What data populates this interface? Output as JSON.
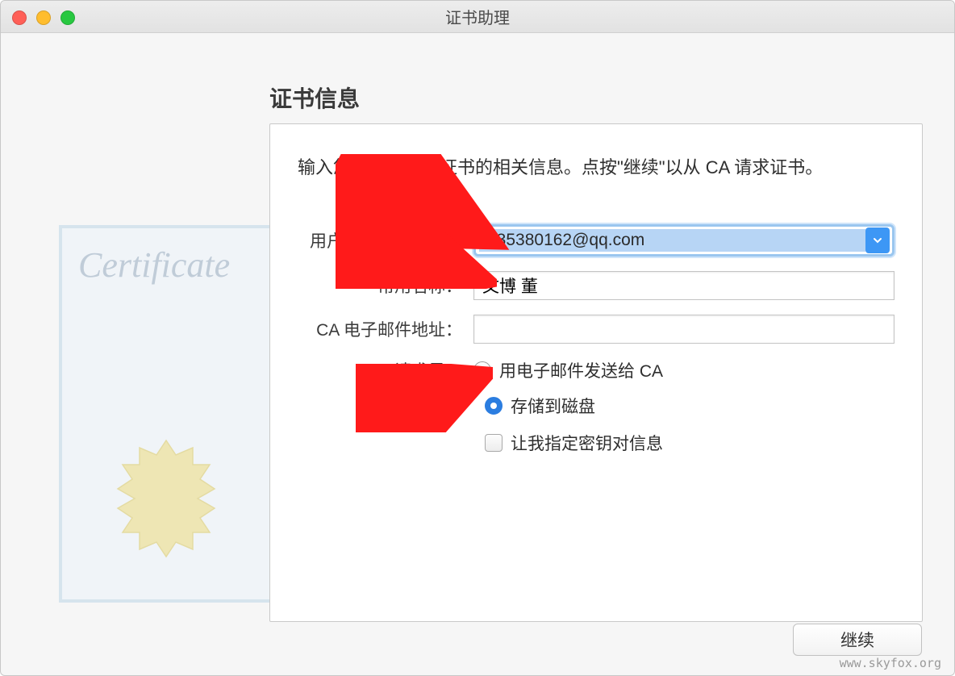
{
  "window": {
    "title": "证书助理"
  },
  "section": {
    "title": "证书信息",
    "instruction": "输入您正在请求的证书的相关信息。点按\"继续\"以从 CA 请求证书。"
  },
  "form": {
    "email_label": "用户电子邮件地址：",
    "email_value": "935380162@qq.com",
    "common_name_label": "常用名称：",
    "common_name_value": "文博 董",
    "ca_email_label": "CA 电子邮件地址：",
    "ca_email_value": "",
    "request_label": "请求是：",
    "option_email_ca": "用电子邮件发送给 CA",
    "option_save_disk": "存储到磁盘",
    "option_specify_keypair": "让我指定密钥对信息",
    "selected_option": "save_disk"
  },
  "buttons": {
    "continue": "继续"
  },
  "decorative": {
    "cert_word": "Certificate"
  },
  "watermark": "www.skyfox.org"
}
